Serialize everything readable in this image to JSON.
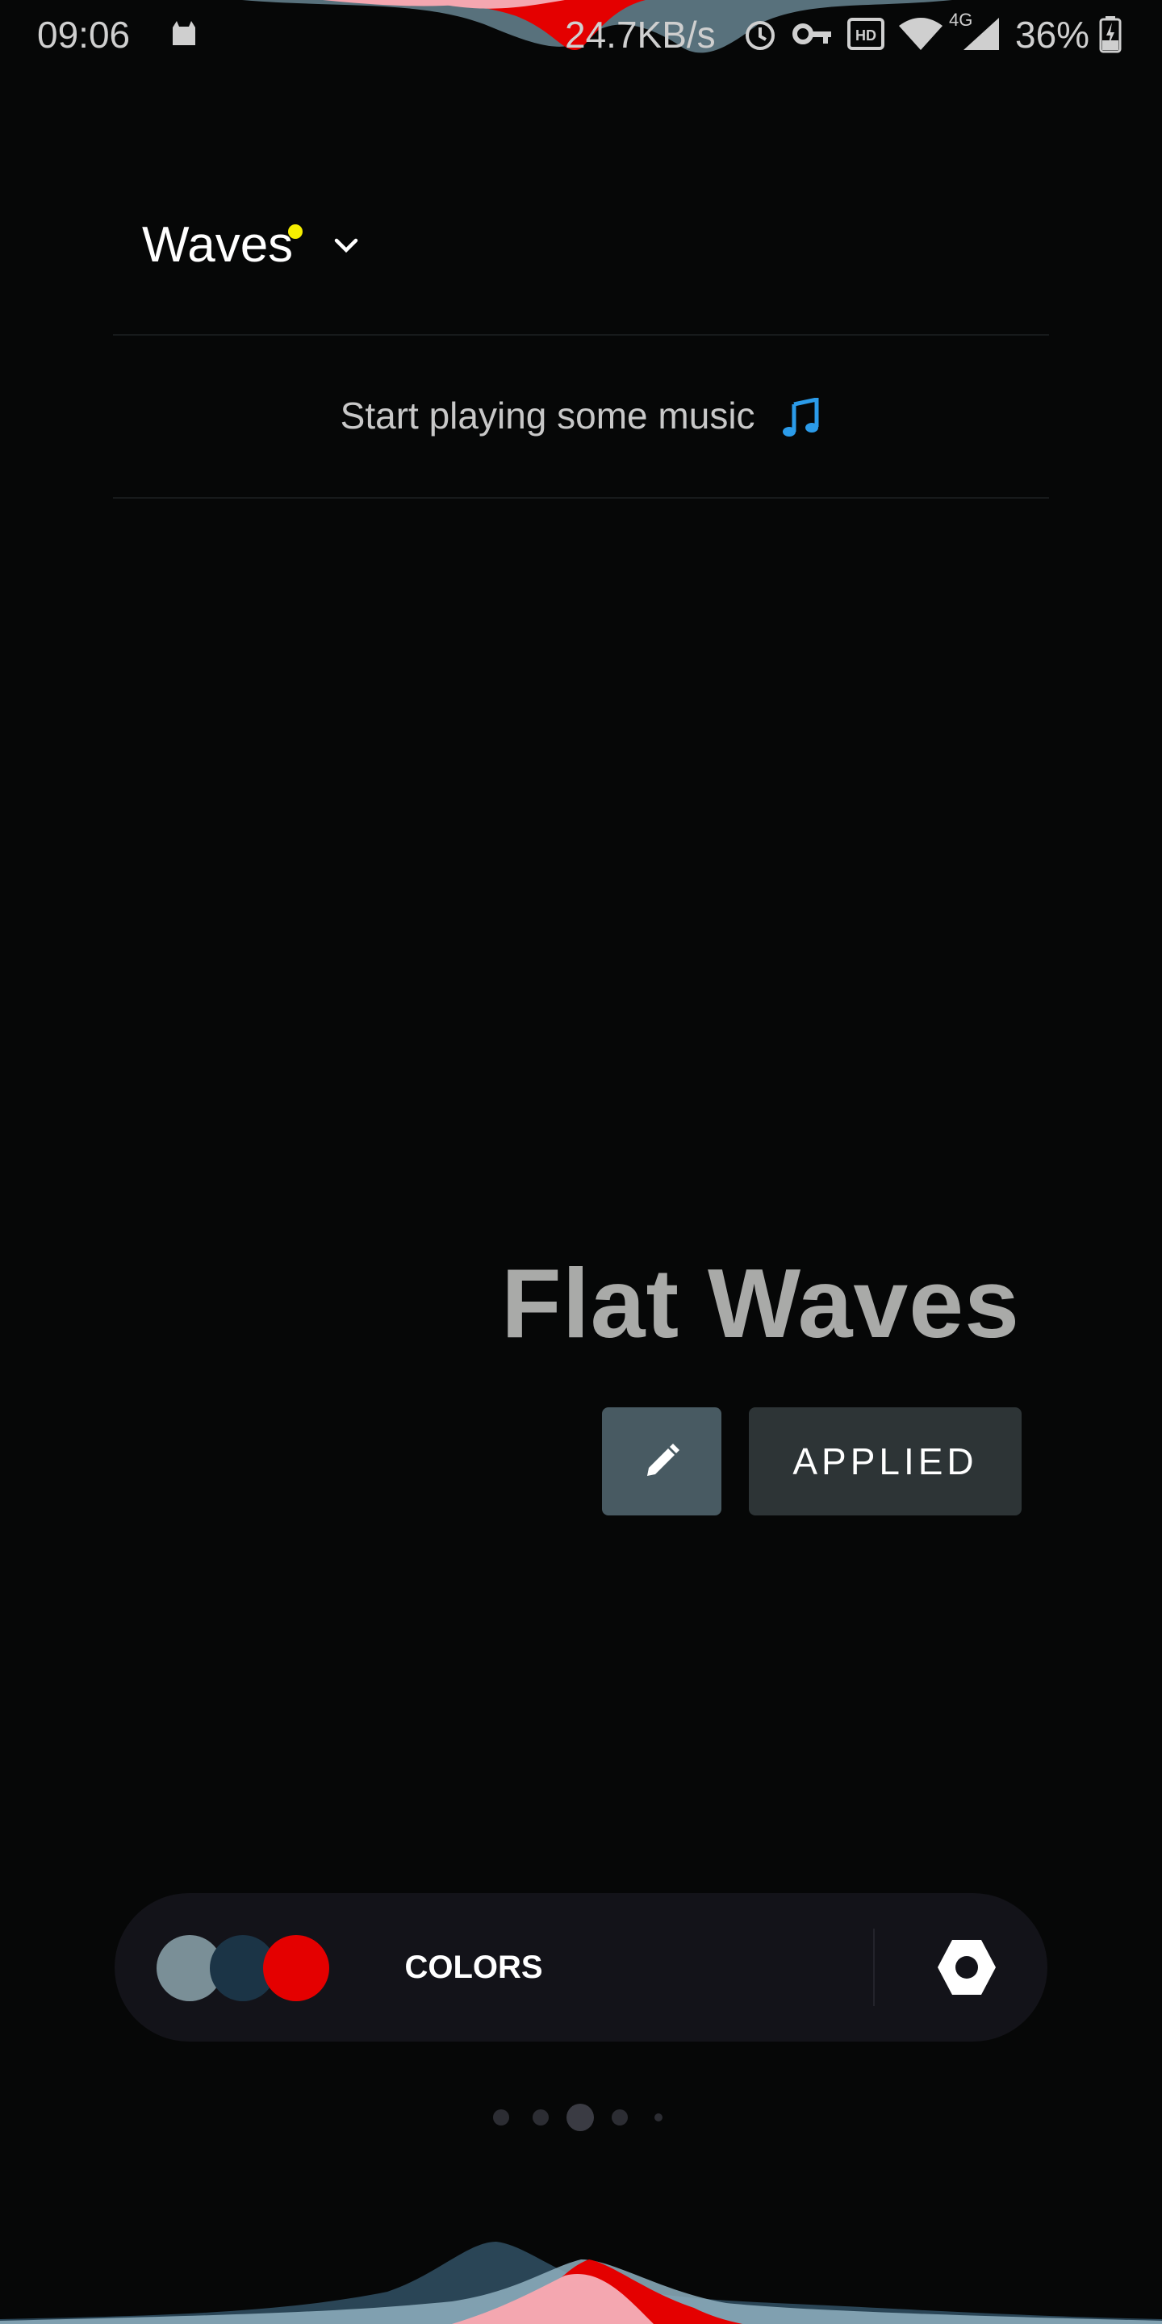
{
  "status_bar": {
    "time": "09:06",
    "net_speed": "24.7KB/s",
    "network": "4G",
    "battery": "36%",
    "icons": [
      "cat-icon",
      "alarm-icon",
      "vpn-key-icon",
      "hd-icon",
      "wifi-icon",
      "signal-icon",
      "battery-charging-icon"
    ]
  },
  "header": {
    "title": "Waves",
    "new_badge_color": "#f5ee00"
  },
  "now_playing": {
    "text": "Start playing some music",
    "icon": "music-note-icon"
  },
  "theme": {
    "name": "Flat Waves",
    "edit_icon": "pencil-icon",
    "applied_label": "APPLIED"
  },
  "colors_bar": {
    "label": "COLORS",
    "swatches": [
      "#7a8f97",
      "#1b3446",
      "#e40000"
    ],
    "settings_icon": "hexagon-nut-icon"
  },
  "pager": {
    "count": 5,
    "active_index": 2
  },
  "palette": {
    "background": "#060707",
    "wave_red": "#e40000",
    "wave_pink": "#f4a7b0",
    "wave_slate": "#8fb0bf",
    "wave_navy": "#2a4556"
  }
}
